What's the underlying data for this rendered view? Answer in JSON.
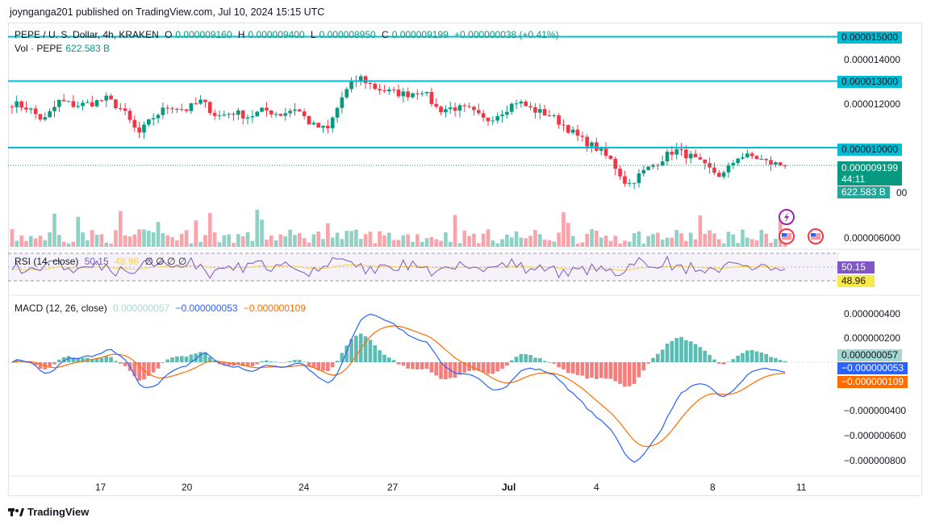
{
  "publisher": "joynganga201 published on TradingView.com, Jul 10, 2024 15:15 UTC",
  "brand": "TradingView",
  "colors": {
    "up": "#089981",
    "down": "#f23645",
    "level": "#00bcd4",
    "macd": "#2962ff",
    "signal": "#ff6d00",
    "rsi": "#7e57c2",
    "rsi_ma": "#f5d24b"
  },
  "legend": {
    "symbol": "PEPE / U. S. Dollar, 4h, KRAKEN",
    "o_label": "O",
    "o": "0.000009160",
    "h_label": "H",
    "h": "0.000009400",
    "l_label": "L",
    "l": "0.000008950",
    "c_label": "C",
    "c": "0.000009199",
    "change": "+0.000000038 (+0.41%)",
    "vol_label": "Vol · PEPE",
    "vol": "622.583 B",
    "rsi_label": "RSI (14, close)",
    "rsi_val": "50.15",
    "rsi_ma_val": "48.96",
    "rsi_empty": "∅ ∅ ∅ ∅",
    "macd_label": "MACD (12, 26, close)",
    "macd_hist": "0.000000057",
    "macd_line": "−0.000000053",
    "macd_signal": "−0.000000109"
  },
  "price_tags": {
    "l15": "0.000015000",
    "l13": "0.000013000",
    "l10": "0.000010000",
    "last": "0.000009199",
    "countdown": "44:11",
    "vol": "622.583 B",
    "vol_tail": "00"
  },
  "rsi_tags": {
    "rsi": "50.15",
    "ma": "48.96"
  },
  "macd_tags": {
    "hist": "0.000000057",
    "macd": "−0.000000053",
    "signal": "−0.000000109"
  },
  "chart_data": [
    {
      "type": "candlestick",
      "title": "PEPE / U. S. Dollar, 4h, KRAKEN",
      "y_ticks": [
        "0.000014000",
        "0.000012000",
        "0.000006000"
      ],
      "x_ticks": [
        "17",
        "20",
        "24",
        "27",
        "Jul",
        "4",
        "8",
        "11"
      ],
      "horizontal_levels": [
        1.5e-05,
        1.3e-05,
        1e-05
      ],
      "last_price": 9.199e-06,
      "close_path": [
        1.2e-05,
        1.18e-05,
        1.12e-05,
        1.21e-05,
        1.19e-05,
        1.2e-05,
        1.22e-05,
        1.17e-05,
        1.06e-05,
        1.14e-05,
        1.19e-05,
        1.17e-05,
        1.21e-05,
        1.14e-05,
        1.16e-05,
        1.14e-05,
        1.17e-05,
        1.15e-05,
        1.18e-05,
        1.1e-05,
        1.08e-05,
        1.24e-05,
        1.32e-05,
        1.27e-05,
        1.25e-05,
        1.24e-05,
        1.26e-05,
        1.17e-05,
        1.18e-05,
        1.17e-05,
        1.12e-05,
        1.16e-05,
        1.21e-05,
        1.17e-05,
        1.15e-05,
        1.1e-05,
        1.04e-05,
        1e-05,
        9.4e-06,
        8.3e-06,
        8.9e-06,
        9.4e-06,
        9.9e-06,
        9.6e-06,
        9.1e-06,
        8.7e-06,
        9.6e-06,
        9.6e-06,
        9.3e-06,
        9.2e-06
      ]
    },
    {
      "type": "bar",
      "title": "Vol · PEPE",
      "last_value": "622.583 B"
    },
    {
      "type": "line",
      "title": "RSI (14, close)",
      "series": [
        {
          "name": "RSI",
          "last": 50.15
        },
        {
          "name": "RSI MA",
          "last": 48.96
        }
      ]
    },
    {
      "type": "line",
      "title": "MACD (12, 26, close)",
      "y_ticks": [
        "0.000000400",
        "0.000000200",
        "−0.000000400",
        "−0.000000600",
        "−0.000000800"
      ],
      "series": [
        {
          "name": "Histogram",
          "last": 5.7e-08
        },
        {
          "name": "MACD",
          "last": -5.3e-08
        },
        {
          "name": "Signal",
          "last": -1.09e-07
        }
      ]
    }
  ]
}
